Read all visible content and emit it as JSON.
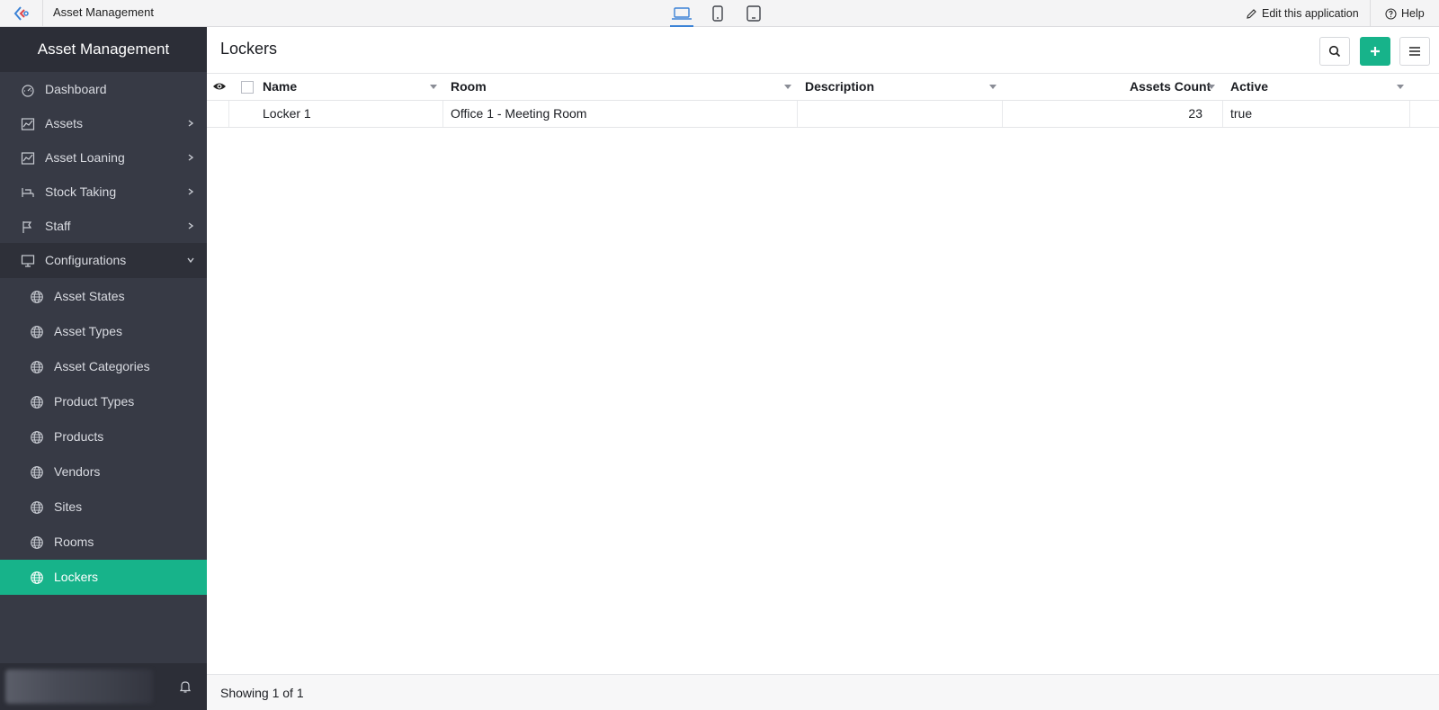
{
  "topbar": {
    "app_name": "Asset Management",
    "edit_label": "Edit this application",
    "help_label": "Help",
    "devices": [
      "laptop-icon",
      "mobile-icon",
      "tablet-icon"
    ]
  },
  "sidebar": {
    "title": "Asset Management",
    "items": [
      {
        "label": "Dashboard",
        "icon": "dashboard-icon"
      },
      {
        "label": "Assets",
        "icon": "chart-icon"
      },
      {
        "label": "Asset Loaning",
        "icon": "chart-icon"
      },
      {
        "label": "Stock Taking",
        "icon": "desk-icon"
      },
      {
        "label": "Staff",
        "icon": "flag-icon"
      },
      {
        "label": "Configurations",
        "icon": "monitor-icon"
      }
    ],
    "sub_items": [
      {
        "label": "Asset States"
      },
      {
        "label": "Asset Types"
      },
      {
        "label": "Asset Categories"
      },
      {
        "label": "Product Types"
      },
      {
        "label": "Products"
      },
      {
        "label": "Vendors"
      },
      {
        "label": "Sites"
      },
      {
        "label": "Rooms"
      },
      {
        "label": "Lockers"
      }
    ],
    "active_item": "Lockers"
  },
  "main": {
    "title": "Lockers",
    "columns": [
      "Name",
      "Room",
      "Description",
      "Assets Count",
      "Active"
    ],
    "rows": [
      {
        "name": "Locker 1",
        "room": "Office 1 - Meeting Room",
        "description": "",
        "assets_count": "23",
        "active": "true"
      }
    ],
    "footer": "Showing 1 of 1"
  },
  "colors": {
    "accent": "#17b38a",
    "sidebar_bg": "#373a45",
    "sidebar_header": "#2c2e37",
    "device_active": "#3b82d6"
  }
}
